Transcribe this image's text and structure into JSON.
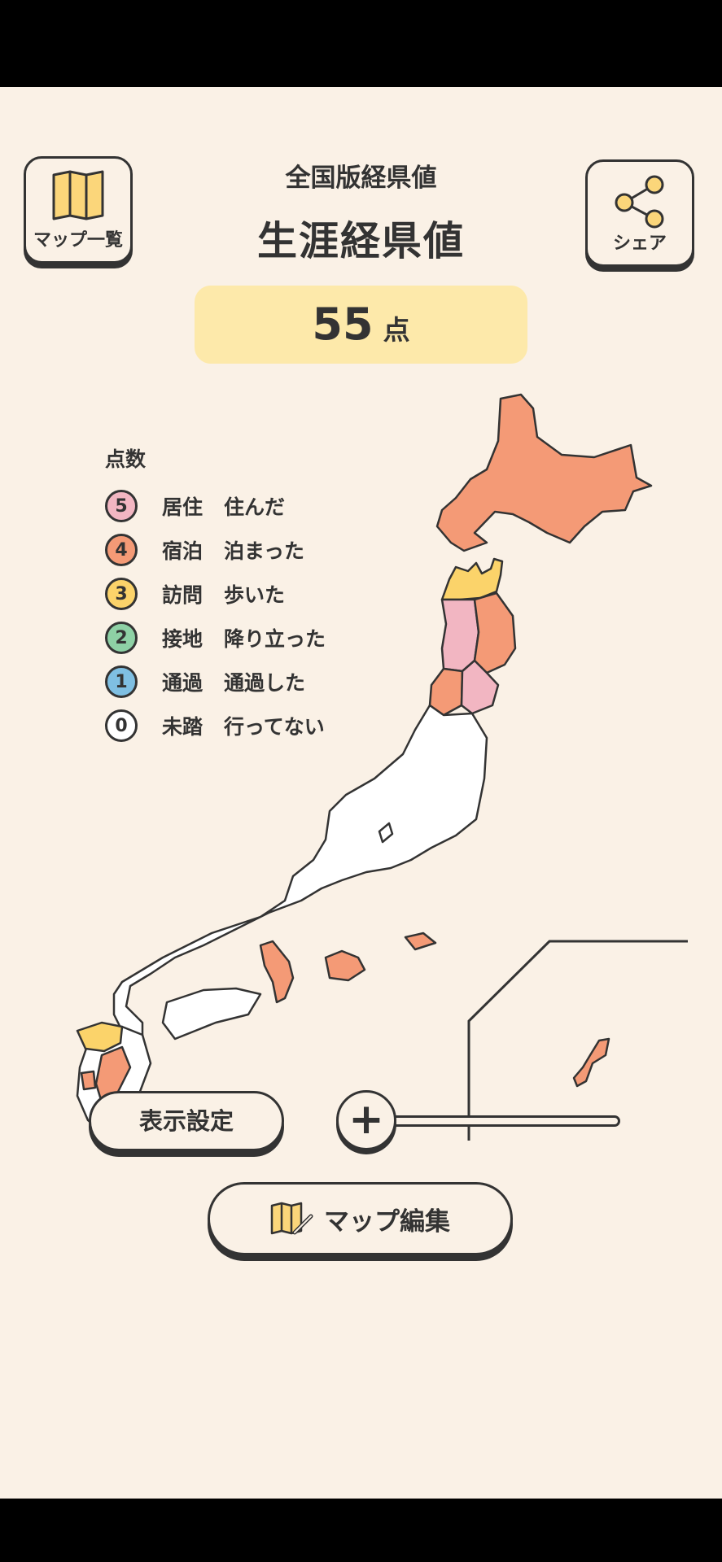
{
  "header": {
    "map_list_label": "マップ一覧",
    "subtitle": "全国版経県値",
    "title": "生涯経県値",
    "share_label": "シェア"
  },
  "score": {
    "value": "55",
    "unit": "点"
  },
  "legend": {
    "title": "点数",
    "items": [
      {
        "num": "5",
        "category": "居住",
        "desc": "住んだ",
        "color": "#f2b6c2"
      },
      {
        "num": "4",
        "category": "宿泊",
        "desc": "泊まった",
        "color": "#f49a76"
      },
      {
        "num": "3",
        "category": "訪問",
        "desc": "歩いた",
        "color": "#fbd36a"
      },
      {
        "num": "2",
        "category": "接地",
        "desc": "降り立った",
        "color": "#8ed1a5"
      },
      {
        "num": "1",
        "category": "通過",
        "desc": "通過した",
        "color": "#7fbfe2"
      },
      {
        "num": "0",
        "category": "未踏",
        "desc": "行ってない",
        "color": "#ffffff"
      }
    ]
  },
  "controls": {
    "display_settings_label": "表示設定",
    "zoom_symbol": "+",
    "edit_map_label": "マップ編集"
  }
}
